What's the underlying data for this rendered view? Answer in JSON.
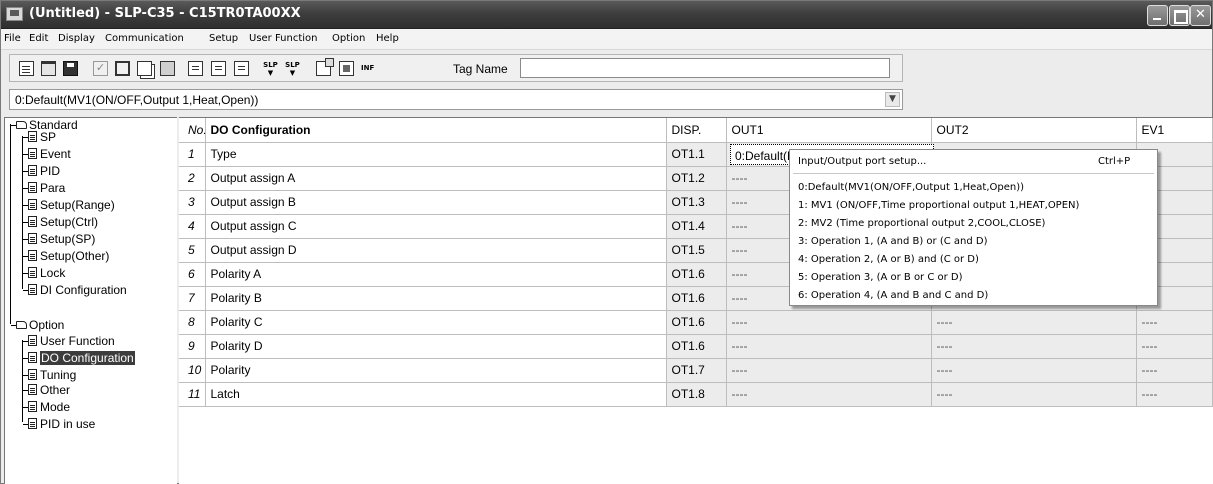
{
  "window": {
    "title": "(Untitled) - SLP-C35 - C15TR0TA00XX"
  },
  "menu": [
    "File",
    "Edit",
    "Display",
    "Communication",
    "Setup",
    "User Function",
    "Option",
    "Help"
  ],
  "toolbar": {
    "icons": [
      "new-icon",
      "open-icon",
      "save-icon",
      "check-icon",
      "frame-icon",
      "copy-icon",
      "paste-icon",
      "page-icon",
      "page-icon",
      "page-icon",
      "slp-upload-icon",
      "slp-download-icon",
      "properties-icon",
      "chip-icon",
      "flag-icon"
    ],
    "slp_label": "SLP",
    "flag_label": "INF",
    "tag_name_label": "Tag Name",
    "tag_name_value": ""
  },
  "preset_combo": {
    "selected": "0:Default(MV1(ON/OFF,Output 1,Heat,Open))"
  },
  "tree": {
    "standard": {
      "label": "Standard",
      "items": [
        "SP",
        "Event",
        "PID",
        "Para",
        "Setup(Range)",
        "Setup(Ctrl)",
        "Setup(SP)",
        "Setup(Other)",
        "Lock",
        "DI Configuration"
      ]
    },
    "option": {
      "label": "Option",
      "items": [
        "User Function",
        "DO Configuration",
        "Tuning",
        "Other",
        "Mode",
        "PID in use"
      ],
      "selected": "DO Configuration"
    }
  },
  "grid": {
    "headers": [
      "No.",
      "DO Configuration",
      "DISP.",
      "OUT1",
      "OUT2",
      "EV1"
    ],
    "rows": [
      {
        "no": "1",
        "item": "Type",
        "disp": "OT1.1",
        "out1": "",
        "out2": "",
        "ev1": ""
      },
      {
        "no": "2",
        "item": "Output assign A",
        "disp": "OT1.2",
        "out1": "----",
        "out2": "",
        "ev1": ""
      },
      {
        "no": "3",
        "item": "Output assign B",
        "disp": "OT1.3",
        "out1": "----",
        "out2": "",
        "ev1": ""
      },
      {
        "no": "4",
        "item": "Output assign C",
        "disp": "OT1.4",
        "out1": "----",
        "out2": "",
        "ev1": ""
      },
      {
        "no": "5",
        "item": "Output assign D",
        "disp": "OT1.5",
        "out1": "----",
        "out2": "",
        "ev1": ""
      },
      {
        "no": "6",
        "item": "Polarity A",
        "disp": "OT1.6",
        "out1": "----",
        "out2": "",
        "ev1": ""
      },
      {
        "no": "7",
        "item": "Polarity B",
        "disp": "OT1.6",
        "out1": "----",
        "out2": "----",
        "ev1": "----"
      },
      {
        "no": "8",
        "item": "Polarity C",
        "disp": "OT1.6",
        "out1": "----",
        "out2": "----",
        "ev1": "----"
      },
      {
        "no": "9",
        "item": "Polarity D",
        "disp": "OT1.6",
        "out1": "----",
        "out2": "----",
        "ev1": "----"
      },
      {
        "no": "10",
        "item": "Polarity",
        "disp": "OT1.7",
        "out1": "----",
        "out2": "----",
        "ev1": "----"
      },
      {
        "no": "11",
        "item": "Latch",
        "disp": "OT1.8",
        "out1": "----",
        "out2": "----",
        "ev1": "----"
      }
    ],
    "active_cell_text": "0:Default(MV1(ON/OFF,Output 1"
  },
  "context_menu": {
    "header_item": "Input/Output port setup...",
    "shortcut": "Ctrl+P",
    "options": [
      "0:Default(MV1(ON/OFF,Output 1,Heat,Open))",
      "1: MV1 (ON/OFF,Time proportional output 1,HEAT,OPEN)",
      "2: MV2 (Time proportional output 2,COOL,CLOSE)",
      "3: Operation 1, (A and B) or (C and D)",
      "4: Operation 2, (A or B) and (C or D)",
      "5: Operation 3, (A or B or C or D)",
      "6: Operation 4, (A and B and C and D)"
    ]
  }
}
